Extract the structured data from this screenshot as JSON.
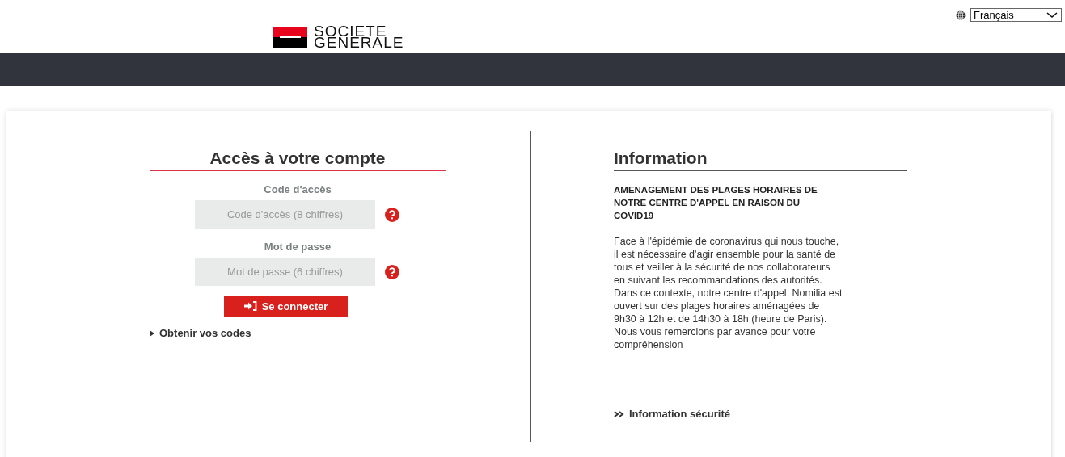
{
  "language": {
    "value": "Français"
  },
  "logo": {
    "lines": [
      "SOCIETE",
      "GENERALE"
    ]
  },
  "login": {
    "title": "Accès à votre compte",
    "fields": [
      {
        "label": "Code d'accès",
        "placeholder": "Code d'accès (8 chiffres)"
      },
      {
        "label": "Mot de passe",
        "placeholder": "Mot de passe (6 chiffres)"
      }
    ],
    "button": "Se connecter",
    "link": "Obtenir vos codes"
  },
  "information": {
    "title": "Information",
    "headline_lines": [
      "AMENAGEMENT DES PLAGES HORAIRES DE",
      "NOTRE CENTRE D'APPEL EN RAISON DU",
      "COVID19"
    ],
    "body_lines": [
      "Face à l'épidémie de coronavirus qui nous touche,",
      "il est nécessaire d'agir ensemble pour la santé de",
      "tous et veiller à la sécurité de nos collaborateurs",
      "en suivant les recommandations des autorités.",
      "Dans ce contexte, notre centre d'appel  Nomilia est",
      "ouvert sur des plages horaires aménagées de",
      "9h30 à 12h et de 14h30 à 18h (heure de Paris).",
      "Nous vous remercions par avance pour votre",
      "compréhension"
    ],
    "link": "Information sécurité"
  }
}
